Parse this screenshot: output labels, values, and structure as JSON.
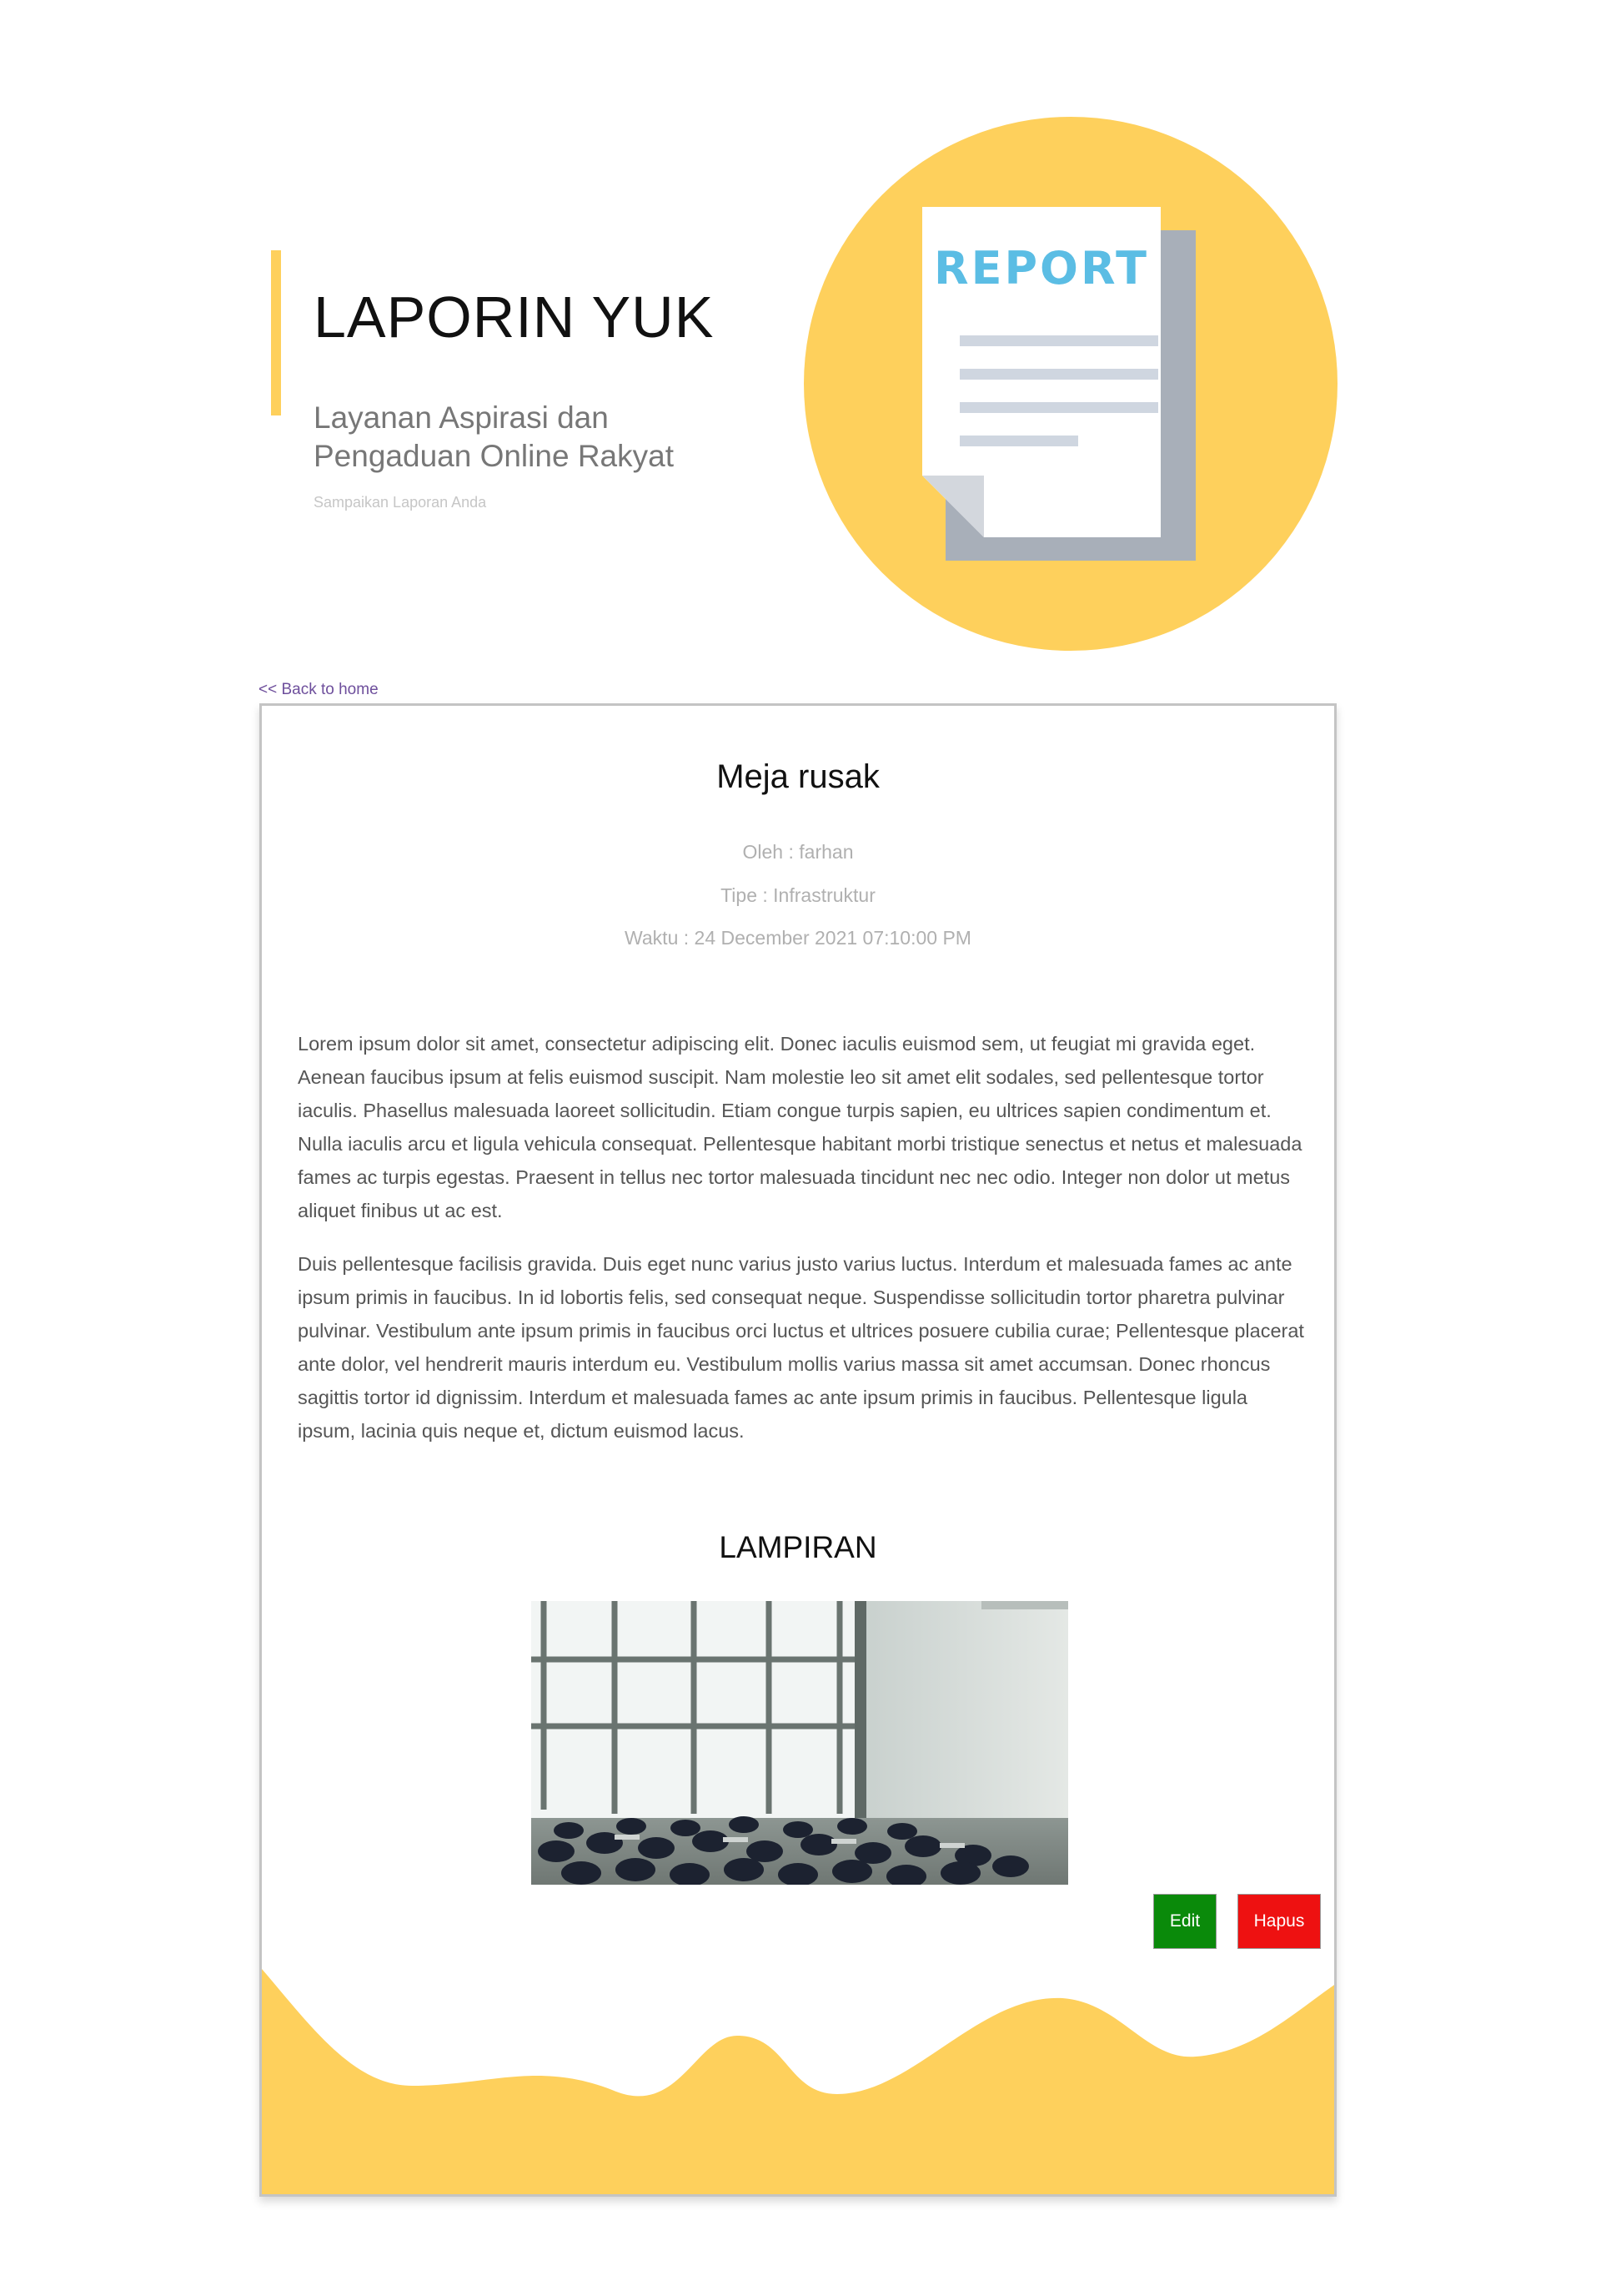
{
  "hero": {
    "title": "LAPORIN YUK",
    "subtitle": "Layanan Aspirasi dan Pengaduan Online Rakyat",
    "tagline": "Sampaikan Laporan Anda",
    "illustration_label": "REPORT"
  },
  "nav": {
    "back_link": "<< Back to home"
  },
  "report": {
    "title": "Meja rusak",
    "author": "Oleh : farhan",
    "type": "Tipe : Infrastruktur",
    "time": "Waktu : 24 December 2021 07:10:00 PM",
    "paragraphs": [
      "Lorem ipsum dolor sit amet, consectetur adipiscing elit. Donec iaculis euismod sem, ut feugiat mi gravida eget. Aenean faucibus ipsum at felis euismod suscipit. Nam molestie leo sit amet elit sodales, sed pellentesque tortor iaculis. Phasellus malesuada laoreet sollicitudin. Etiam congue turpis sapien, eu ultrices sapien condimentum et. Nulla iaculis arcu et ligula vehicula consequat. Pellentesque habitant morbi tristique senectus et netus et malesuada fames ac turpis egestas. Praesent in tellus nec tortor malesuada tincidunt nec nec odio. Integer non dolor ut metus aliquet finibus ut ac est.",
      "Duis pellentesque facilisis gravida. Duis eget nunc varius justo varius luctus. Interdum et malesuada fames ac ante ipsum primis in faucibus. In id lobortis felis, sed consequat neque. Suspendisse sollicitudin tortor pharetra pulvinar pulvinar. Vestibulum ante ipsum primis in faucibus orci luctus et ultrices posuere cubilia curae; Pellentesque placerat ante dolor, vel hendrerit mauris interdum eu. Vestibulum mollis varius massa sit amet accumsan. Donec rhoncus sagittis tortor id dignissim. Interdum et malesuada fames ac ante ipsum primis in faucibus. Pellentesque ligula ipsum, lacinia quis neque et, dictum euismod lacus."
    ]
  },
  "attachment": {
    "heading": "LAMPIRAN"
  },
  "actions": {
    "edit_label": "Edit",
    "delete_label": "Hapus"
  },
  "colors": {
    "accent_yellow": "#fed05c",
    "report_blue": "#5bbde4",
    "edit_green": "#0a8a0a",
    "delete_red": "#ee1111",
    "link_purple": "#6e4f9c"
  }
}
